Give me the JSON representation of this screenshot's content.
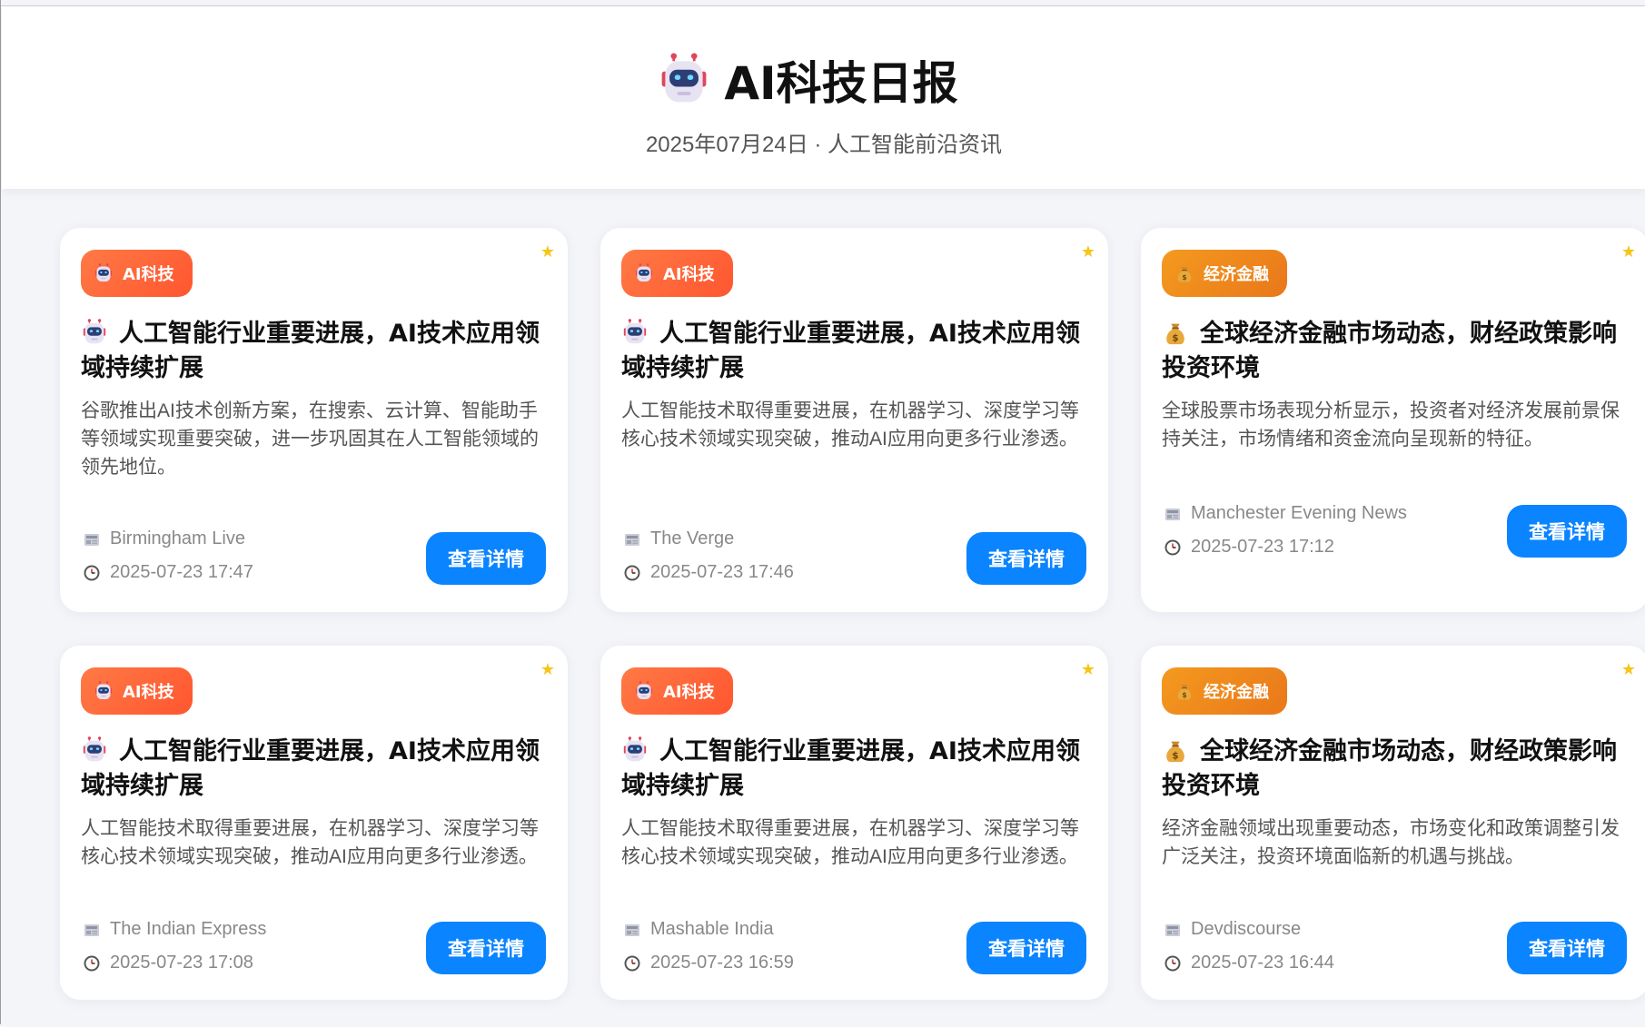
{
  "header": {
    "title": "AI科技日报",
    "subtitle": "2025年07月24日 · 人工智能前沿资讯",
    "icon": "robot-icon"
  },
  "colors": {
    "accent_blue": "#0a84ff",
    "ai_badge": "#ff6a3d",
    "finance_badge": "#ef8a1c",
    "star": "#f5c518"
  },
  "cards": [
    {
      "category": "AI科技",
      "category_icon": "robot-icon",
      "headline": "人工智能行业重要进展，AI技术应用领域持续扩展",
      "summary": "谷歌推出AI技术创新方案，在搜索、云计算、智能助手等领域实现重要突破，进一步巩固其在人工智能领域的领先地位。",
      "source": "Birmingham Live",
      "time": "2025-07-23 17:47",
      "button": "查看详情"
    },
    {
      "category": "AI科技",
      "category_icon": "robot-icon",
      "headline": "人工智能行业重要进展，AI技术应用领域持续扩展",
      "summary": "人工智能技术取得重要进展，在机器学习、深度学习等核心技术领域实现突破，推动AI应用向更多行业渗透。",
      "source": "The Verge",
      "time": "2025-07-23 17:46",
      "button": "查看详情"
    },
    {
      "category": "经济金融",
      "category_icon": "money-bag-icon",
      "headline": "全球经济金融市场动态，财经政策影响投资环境",
      "summary": "全球股票市场表现分析显示，投资者对经济发展前景保持关注，市场情绪和资金流向呈现新的特征。",
      "source": "Manchester Evening News",
      "time": "2025-07-23 17:12",
      "button": "查看详情"
    },
    {
      "category": "AI科技",
      "category_icon": "robot-icon",
      "headline": "人工智能行业重要进展，AI技术应用领域持续扩展",
      "summary": "人工智能技术取得重要进展，在机器学习、深度学习等核心技术领域实现突破，推动AI应用向更多行业渗透。",
      "source": "The Indian Express",
      "time": "2025-07-23 17:08",
      "button": "查看详情"
    },
    {
      "category": "AI科技",
      "category_icon": "robot-icon",
      "headline": "人工智能行业重要进展，AI技术应用领域持续扩展",
      "summary": "人工智能技术取得重要进展，在机器学习、深度学习等核心技术领域实现突破，推动AI应用向更多行业渗透。",
      "source": "Mashable India",
      "time": "2025-07-23 16:59",
      "button": "查看详情"
    },
    {
      "category": "经济金融",
      "category_icon": "money-bag-icon",
      "headline": "全球经济金融市场动态，财经政策影响投资环境",
      "summary": "经济金融领域出现重要动态，市场变化和政策调整引发广泛关注，投资环境面临新的机遇与挑战。",
      "source": "Devdiscourse",
      "time": "2025-07-23 16:44",
      "button": "查看详情"
    }
  ]
}
